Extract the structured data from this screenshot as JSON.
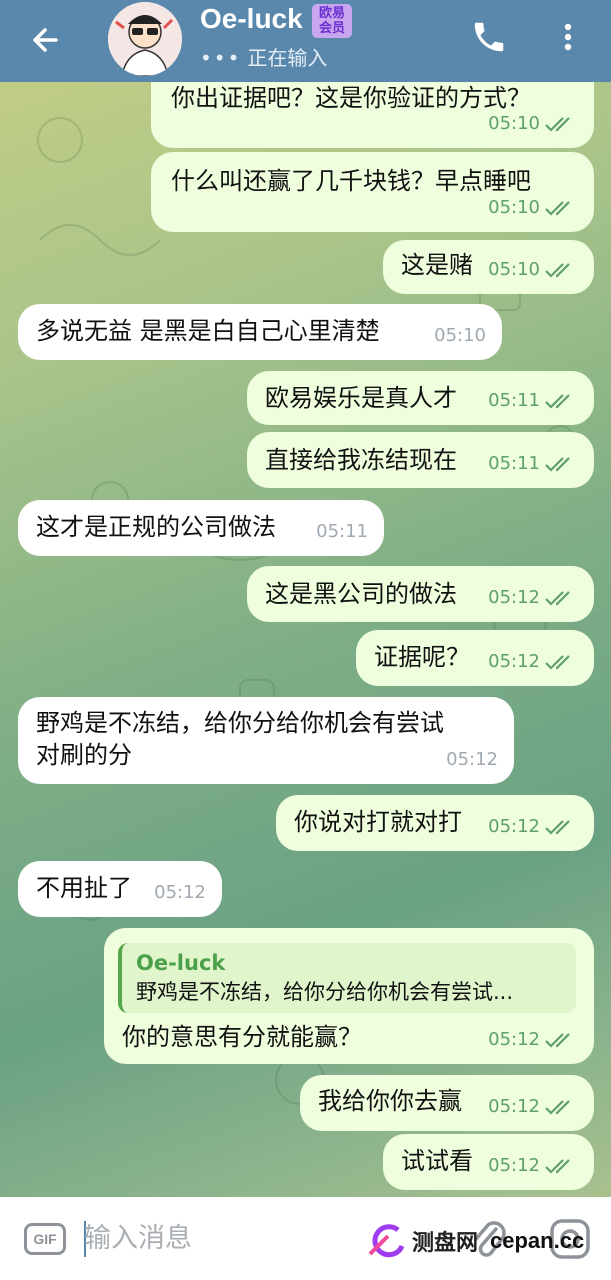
{
  "header": {
    "title": "Oe-luck",
    "badge_line1": "欧易",
    "badge_line2": "会员",
    "status": "正在输入"
  },
  "messages": [
    {
      "dir": "out",
      "text": "你出证据吧？这是你验证的方式？",
      "time": "05:10"
    },
    {
      "dir": "out",
      "text": "什么叫还赢了几千块钱？早点睡吧",
      "time": "05:10"
    },
    {
      "dir": "out",
      "text": "这是赌",
      "time": "05:10"
    },
    {
      "dir": "in",
      "text": "多说无益 是黑是白自己心里清楚",
      "time": "05:10"
    },
    {
      "dir": "out",
      "text": "欧易娱乐是真人才",
      "time": "05:11"
    },
    {
      "dir": "out",
      "text": "直接给我冻结现在",
      "time": "05:11"
    },
    {
      "dir": "in",
      "text": "这才是正规的公司做法",
      "time": "05:11"
    },
    {
      "dir": "out",
      "text": "这是黑公司的做法",
      "time": "05:12"
    },
    {
      "dir": "out",
      "text": "证据呢？",
      "time": "05:12"
    },
    {
      "dir": "in",
      "text": "野鸡是不冻结，给你分给你机会有尝试",
      "text2": "对刷的分",
      "time": "05:12"
    },
    {
      "dir": "out",
      "text": "你说对打就对打",
      "time": "05:12"
    },
    {
      "dir": "in",
      "text": "不用扯了",
      "time": "05:12"
    },
    {
      "dir": "out",
      "text": "你的意思有分就能赢？",
      "time": "05:12",
      "reply_name": "Oe-luck",
      "reply_text": "野鸡是不冻结，给你分给你机会有尝试..."
    },
    {
      "dir": "out",
      "text": "我给你你去赢",
      "time": "05:12"
    },
    {
      "dir": "out",
      "text": "试试看",
      "time": "05:12"
    }
  ],
  "input": {
    "gif_label": "GIF",
    "placeholder": "输入消息"
  },
  "watermark": {
    "text1": "测盘网",
    "text2": "cepan.cc"
  },
  "colors": {
    "header": "#5a88ad",
    "outgoing_bubble": "#effedd",
    "incoming_bubble": "#ffffff",
    "tick_green": "#5fa06a"
  }
}
